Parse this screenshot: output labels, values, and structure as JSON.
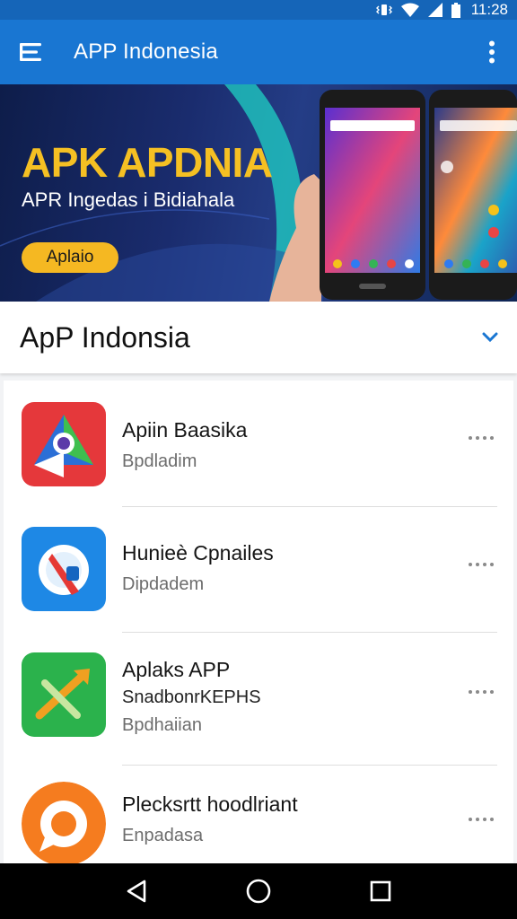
{
  "status_bar": {
    "time": "11:28",
    "icons": [
      "vibrate-icon",
      "wifi-icon",
      "signal-icon",
      "battery-icon"
    ]
  },
  "app_bar": {
    "title": "APP Indonesia",
    "menu_icon": "hamburger-menu-icon",
    "overflow_icon": "more-vertical-icon"
  },
  "banner": {
    "title": "APK APDNIA",
    "subtitle": "APR Ingedas i Bidiahala",
    "button_label": "Aplaio"
  },
  "section": {
    "title": "ApP Indonsia",
    "expand_icon": "chevron-down-icon"
  },
  "apps": [
    {
      "name": "Apiin Baasika",
      "subtitle": "Bpdladim",
      "extra": "",
      "icon": "navigation-diamond-icon"
    },
    {
      "name": "Hunieè Cpnailes",
      "subtitle": "Dipdadem",
      "extra": "",
      "icon": "compass-icon"
    },
    {
      "name": "Aplaks APP",
      "subtitle": "Bpdhaiian",
      "extra": "SnadbonrKEPHS",
      "icon": "leaf-arrow-icon"
    },
    {
      "name": "Plecksrtt hoodlriant",
      "subtitle": "Enpadasa",
      "extra": "",
      "icon": "chat-ring-icon"
    }
  ],
  "nav_bar": {
    "back_icon": "back-triangle-icon",
    "home_icon": "home-circle-icon",
    "recents_icon": "recents-square-icon"
  },
  "colors": {
    "primary": "#1976d2",
    "status_bar": "#1565b8",
    "banner_accent": "#f5c023",
    "nav_bar": "#000000"
  }
}
